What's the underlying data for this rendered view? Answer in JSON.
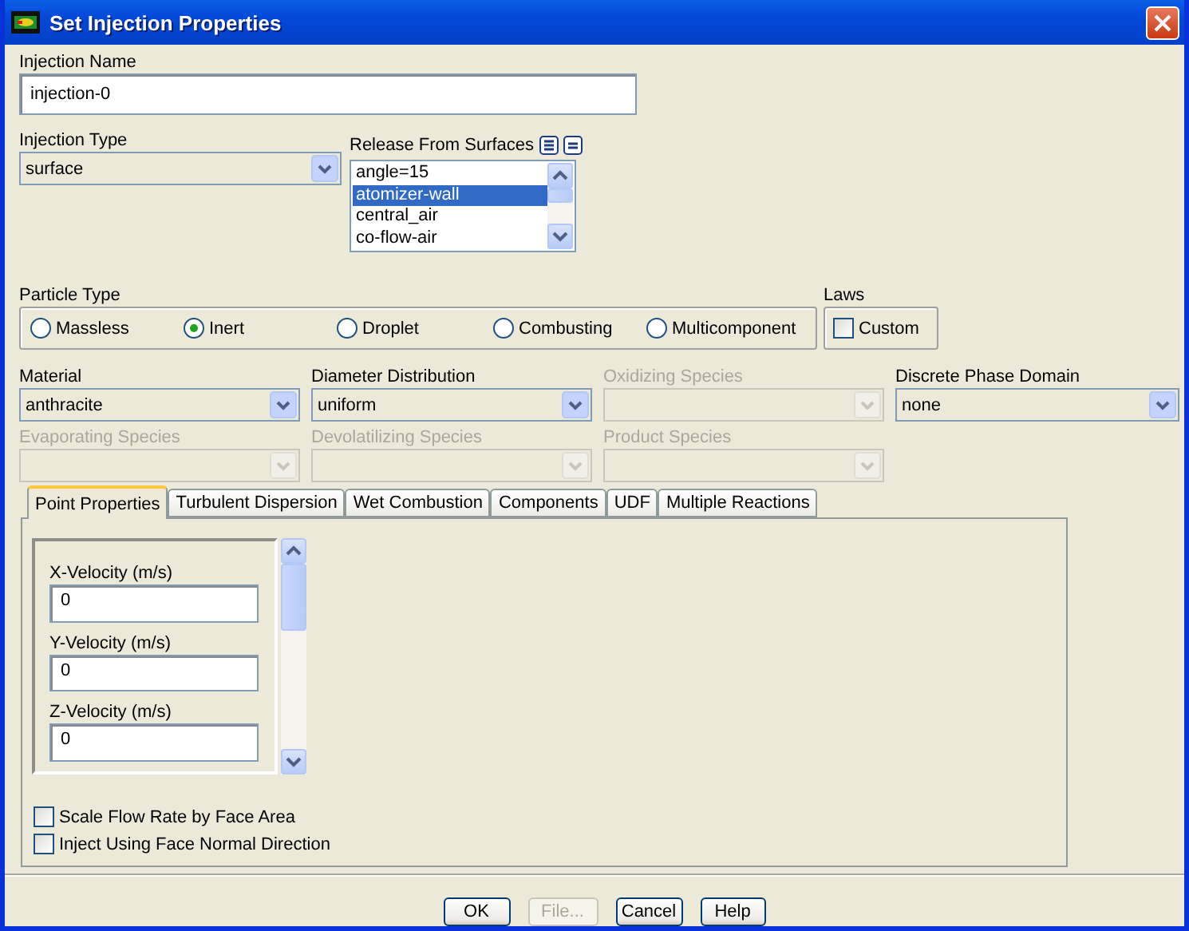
{
  "window": {
    "title": "Set Injection Properties"
  },
  "injection_name": {
    "label": "Injection Name",
    "value": "injection-0"
  },
  "injection_type": {
    "label": "Injection Type",
    "value": "surface"
  },
  "release_surfaces": {
    "label": "Release From Surfaces",
    "items": [
      {
        "label": "angle=15",
        "selected": false
      },
      {
        "label": "atomizer-wall",
        "selected": true
      },
      {
        "label": "central_air",
        "selected": false
      },
      {
        "label": "co-flow-air",
        "selected": false
      }
    ]
  },
  "particle_type": {
    "label": "Particle Type",
    "options": [
      {
        "label": "Massless",
        "selected": false
      },
      {
        "label": "Inert",
        "selected": true
      },
      {
        "label": "Droplet",
        "selected": false
      },
      {
        "label": "Combusting",
        "selected": false
      },
      {
        "label": "Multicomponent",
        "selected": false
      }
    ]
  },
  "laws": {
    "label": "Laws",
    "custom": {
      "label": "Custom",
      "checked": false
    }
  },
  "combos": [
    {
      "label": "Material",
      "value": "anthracite",
      "disabled": false
    },
    {
      "label": "Diameter Distribution",
      "value": "uniform",
      "disabled": false
    },
    {
      "label": "Oxidizing Species",
      "disabled": true
    },
    {
      "label": "Discrete Phase Domain",
      "value": "none",
      "disabled": false
    },
    {
      "label": "Evaporating Species",
      "disabled": true
    },
    {
      "label": "Devolatilizing Species",
      "disabled": true
    },
    {
      "label": "Product Species",
      "disabled": true
    }
  ],
  "tabs": [
    {
      "label": "Point Properties",
      "selected": true
    },
    {
      "label": "Turbulent Dispersion",
      "selected": false
    },
    {
      "label": "Wet Combustion",
      "selected": false
    },
    {
      "label": "Components",
      "selected": false
    },
    {
      "label": "UDF",
      "selected": false
    },
    {
      "label": "Multiple Reactions",
      "selected": false
    }
  ],
  "point_properties": [
    {
      "label": "X-Velocity (m/s)",
      "value": "0"
    },
    {
      "label": "Y-Velocity (m/s)",
      "value": "0"
    },
    {
      "label": "Z-Velocity (m/s)",
      "value": "0"
    }
  ],
  "options": [
    {
      "label": "Scale Flow Rate by Face Area",
      "checked": false
    },
    {
      "label": "Inject Using Face Normal Direction",
      "checked": false
    }
  ],
  "buttons": [
    {
      "label": "OK",
      "disabled": false
    },
    {
      "label": "File...",
      "disabled": true
    },
    {
      "label": "Cancel",
      "disabled": false
    },
    {
      "label": "Help",
      "disabled": false
    }
  ]
}
